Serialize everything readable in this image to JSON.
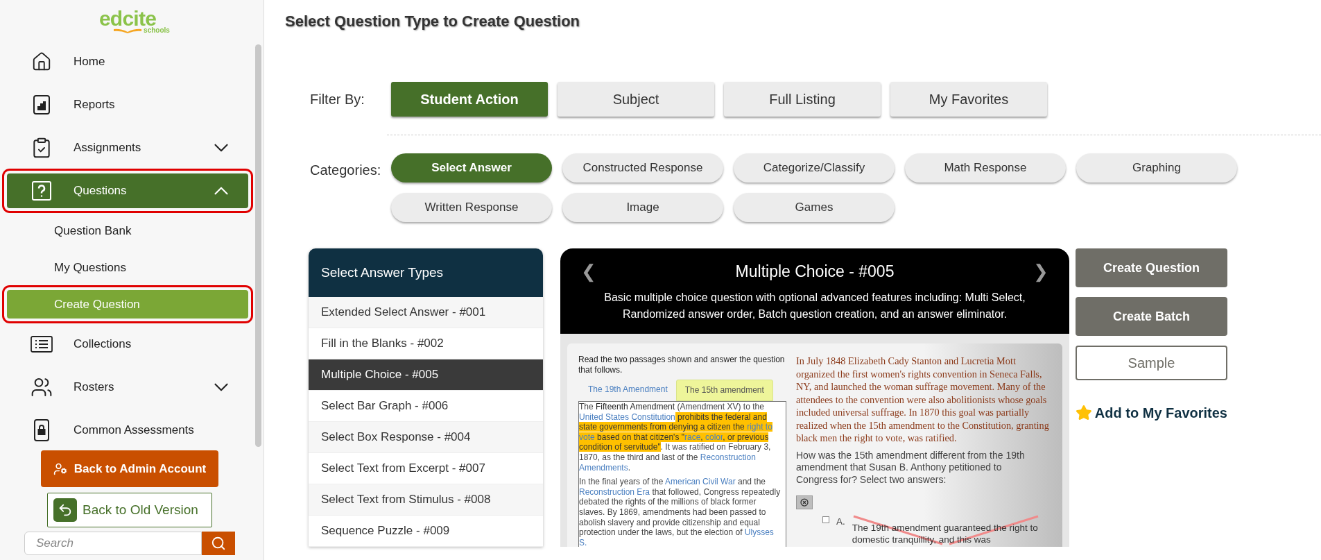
{
  "logo": {
    "name": "edcite",
    "tagline": "schools"
  },
  "sidebar": {
    "items": [
      {
        "kind": "link",
        "label": "Home",
        "selected": false
      },
      {
        "kind": "link",
        "label": "Reports",
        "selected": false
      },
      {
        "kind": "group",
        "label": "Assignments",
        "selected": false,
        "expanded": false
      },
      {
        "kind": "group",
        "label": "Questions",
        "selected": true,
        "expanded": true,
        "highlighted": true
      },
      {
        "kind": "sub",
        "label": "Question Bank",
        "selected": false,
        "highlighted": false
      },
      {
        "kind": "sub",
        "label": "My Questions",
        "selected": false,
        "highlighted": false
      },
      {
        "kind": "sub",
        "label": "Create Question",
        "selected": true,
        "highlighted": true
      },
      {
        "kind": "link",
        "label": "Collections",
        "selected": false
      },
      {
        "kind": "group",
        "label": "Rosters",
        "selected": false,
        "expanded": false
      },
      {
        "kind": "link",
        "label": "Common Assessments",
        "selected": false
      }
    ],
    "admin_button": "Back to Admin Account",
    "old_version_button": "Back to Old Version",
    "search": {
      "placeholder": "Search"
    }
  },
  "title": "Select Question Type to Create Question",
  "filter": {
    "label": "Filter By:",
    "tabs": [
      {
        "label": "Student Action",
        "selected": true
      },
      {
        "label": "Subject",
        "selected": false
      },
      {
        "label": "Full Listing",
        "selected": false
      },
      {
        "label": "My Favorites",
        "selected": false
      }
    ]
  },
  "categories": {
    "label": "Categories:",
    "items": [
      {
        "label": "Select Answer",
        "selected": true
      },
      {
        "label": "Constructed Response",
        "selected": false
      },
      {
        "label": "Categorize/Classify",
        "selected": false
      },
      {
        "label": "Math Response",
        "selected": false
      },
      {
        "label": "Graphing",
        "selected": false
      },
      {
        "label": "Written Response",
        "selected": false
      },
      {
        "label": "Image",
        "selected": false
      },
      {
        "label": "Games",
        "selected": false
      }
    ]
  },
  "types": {
    "title": "Select Answer Types",
    "items": [
      {
        "label": "Extended Select Answer - #001",
        "selected": false
      },
      {
        "label": "Fill in the Blanks - #002",
        "selected": false
      },
      {
        "label": "Multiple Choice - #005",
        "selected": true
      },
      {
        "label": "Select Bar Graph - #006",
        "selected": false
      },
      {
        "label": "Select Box Response - #004",
        "selected": false
      },
      {
        "label": "Select Text from Excerpt - #007",
        "selected": false
      },
      {
        "label": "Select Text from Stimulus - #008",
        "selected": false
      },
      {
        "label": "Sequence Puzzle - #009",
        "selected": false
      }
    ]
  },
  "preview": {
    "prev": "❮",
    "title": "Multiple Choice - #005",
    "next": "❯",
    "description": "Basic multiple choice question with optional advanced features including: Multi Select, Randomized answer order, Batch question creation, and an answer eliminator.",
    "sample": {
      "instructions": "Read the two passages shown and answer the question that follows.",
      "tabs": [
        {
          "label": "The 19th Amendment",
          "selected": false
        },
        {
          "label": "The 15th amendment",
          "selected": true
        }
      ],
      "passage": [
        [
          {
            "kind": "plain",
            "t": "The "
          },
          {
            "kind": "dark",
            "t": "Fifteenth Amendment"
          },
          {
            "kind": "plain",
            "t": " (Amendment XV) to the "
          },
          {
            "kind": "link",
            "t": "United States Constitution"
          },
          {
            "kind": "mark",
            "t": " prohibits the federal and state governments from denying a citizen the "
          },
          {
            "kind": "mark_link",
            "t": "right to vote"
          },
          {
            "kind": "mark",
            "t": " based on that citizen's \""
          },
          {
            "kind": "mark_link",
            "t": "race"
          },
          {
            "kind": "mark",
            "t": ", "
          },
          {
            "kind": "mark_link",
            "t": "color"
          },
          {
            "kind": "mark",
            "t": ", or previous condition of servitude\""
          },
          {
            "kind": "plain",
            "t": ". It was ratified on February 3, 1870, as the third and last of the "
          },
          {
            "kind": "link",
            "t": "Reconstruction Amendments"
          },
          {
            "kind": "plain",
            "t": "."
          }
        ],
        [
          {
            "kind": "plain",
            "t": "In the final years of the "
          },
          {
            "kind": "link",
            "t": "American Civil War"
          },
          {
            "kind": "plain",
            "t": " and the "
          },
          {
            "kind": "link",
            "t": "Reconstruction Era"
          },
          {
            "kind": "plain",
            "t": " that followed, Congress repeatedly debated the rights of the millions of black former slaves. By 1869, amendments had been passed to abolish slavery and provide citizenship and equal protection under the laws, but the election of "
          },
          {
            "kind": "link",
            "t": "Ulysses S."
          }
        ]
      ],
      "story": "In July 1848 Elizabeth Cady Stanton and Lucretia Mott organized the first women's rights convention in Seneca Falls, NY, and launched the woman suffrage movement. Many of the attendees to the convention were also abolitionists whose goals included universal suffrage. In 1870 this goal was partially realized when the 15th amendment to the Constitution, granting black men the right to vote, was ratified.",
      "question": "How was the 15th amendment different from the 19th amendment that Susan B. Anthony petitioned to Congress for? Select two answers:",
      "answers": [
        {
          "letter": "A.",
          "text": "The 19th amendment guaranteed the right to domestic tranquillity, and this was",
          "checked": false,
          "eliminated": true
        }
      ]
    }
  },
  "actions": {
    "create_question": "Create Question",
    "create_batch": "Create Batch",
    "sample": "Sample",
    "favorite": "Add to My Favorites"
  }
}
